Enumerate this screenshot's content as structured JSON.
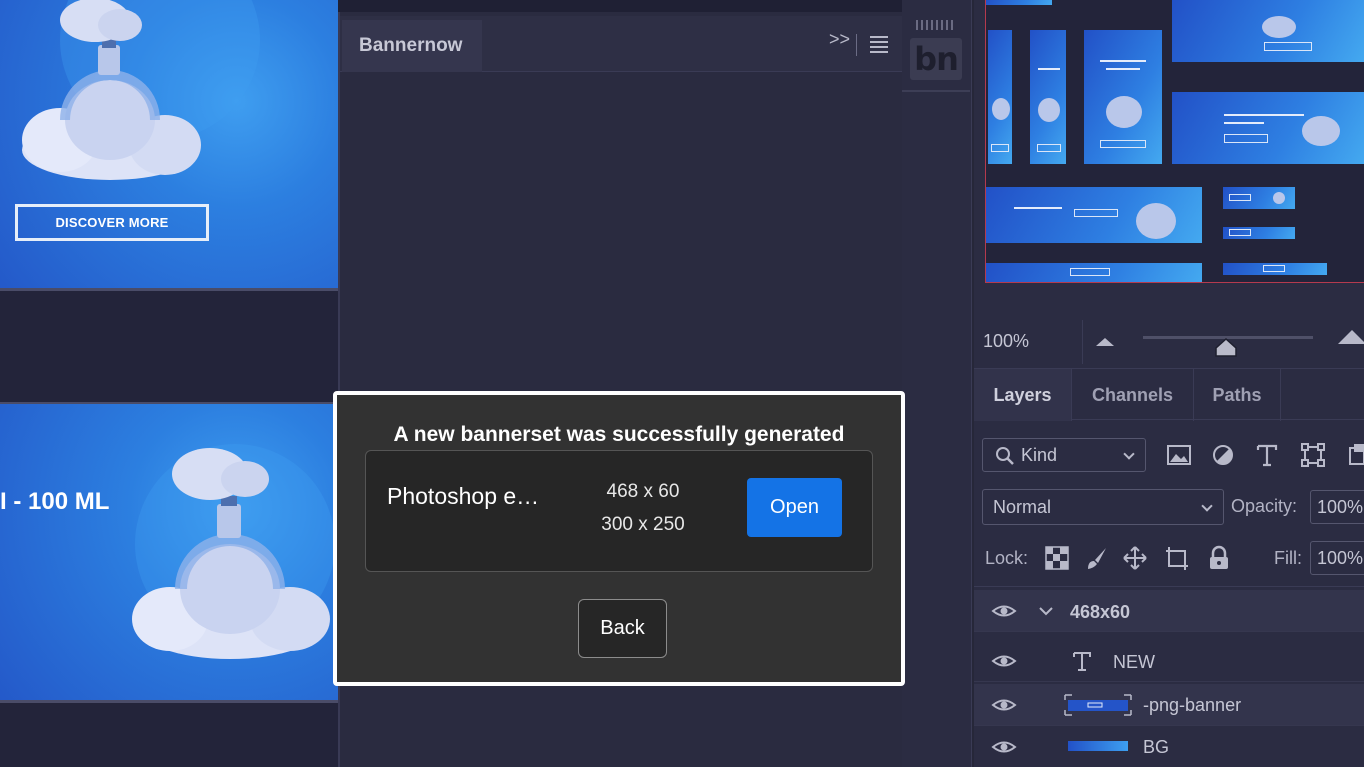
{
  "canvas": {
    "banner1_button": "DISCOVER MORE",
    "banner2_text": "I - 100 ML"
  },
  "plugin_panel": {
    "tab_label": "Bannernow",
    "logo_text": "bn"
  },
  "modal": {
    "title": "A new bannerset was successfully generated",
    "result_name": "Photoshop e…",
    "sizes": [
      "468 x 60",
      "300 x 250"
    ],
    "open_label": "Open",
    "back_label": "Back"
  },
  "navigator": {
    "zoom": "100%"
  },
  "layers_panel": {
    "tabs": [
      "Layers",
      "Channels",
      "Paths"
    ],
    "kind_label": "Kind",
    "blend_mode": "Normal",
    "opacity_label": "Opacity:",
    "opacity_value": "100%",
    "lock_label": "Lock:",
    "fill_label": "Fill:",
    "fill_value": "100%",
    "layers": [
      {
        "name": "468x60"
      },
      {
        "name": "NEW"
      },
      {
        "name": "-png-banner"
      },
      {
        "name": "BG"
      }
    ]
  },
  "colors": {
    "accent": "#1473e6",
    "panel_bg": "#2b2c42",
    "modal_bg": "#323232",
    "banner_blue": "#2c7fe0"
  }
}
